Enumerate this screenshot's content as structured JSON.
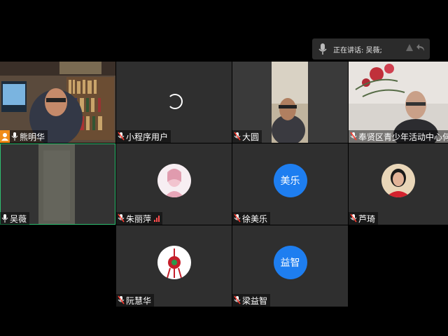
{
  "speaking": {
    "label": "正在讲话: 吴薇;"
  },
  "tiles": [
    {
      "name": "熊明华",
      "type": "video",
      "host": true
    },
    {
      "name": "小程序用户",
      "type": "loading"
    },
    {
      "name": "大圆",
      "type": "video"
    },
    {
      "name": "奉贤区青少年活动中心何琪",
      "type": "video"
    },
    {
      "name": "吴薇",
      "type": "video",
      "active": true,
      "mic": "on"
    },
    {
      "name": "朱丽萍",
      "type": "avatar-photo"
    },
    {
      "name": "徐美乐",
      "type": "avatar-text",
      "initials": "美乐"
    },
    {
      "name": "芦琦",
      "type": "avatar-photo"
    },
    {
      "name": "阮慧华",
      "type": "avatar-photo"
    },
    {
      "name": "梁益智",
      "type": "avatar-text",
      "initials": "益智"
    }
  ],
  "colors": {
    "accent": "#1e7ef0",
    "active_border": "#2fbf71",
    "host_badge": "#f08c1a",
    "muted_mic": "#ff3b30"
  }
}
